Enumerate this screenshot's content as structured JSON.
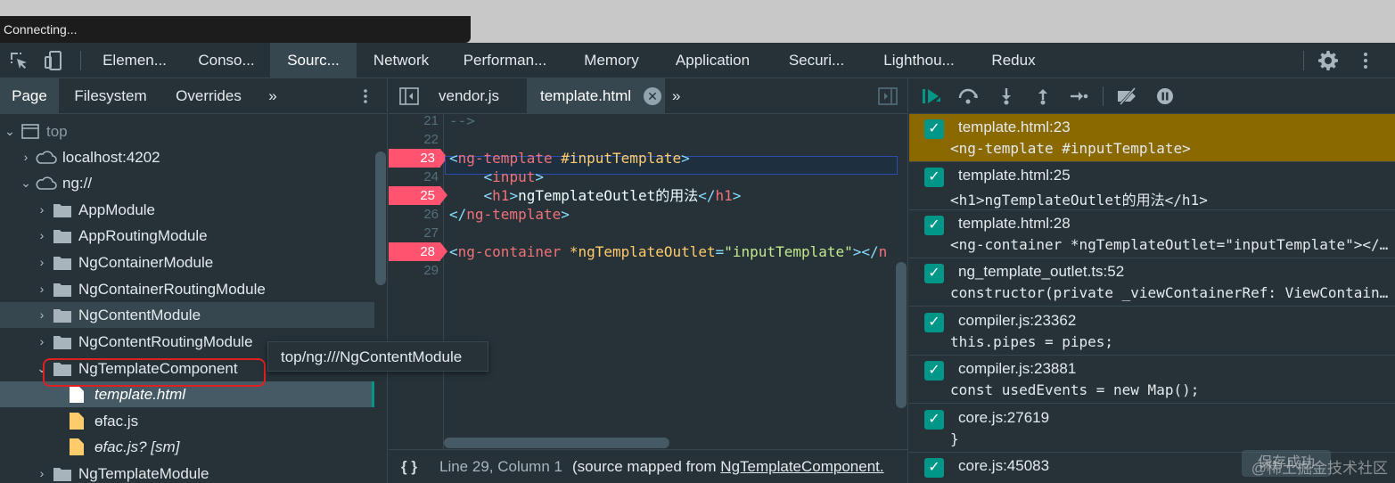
{
  "status_banner": "Connecting...",
  "main_tabs": [
    {
      "label": "Elemen..."
    },
    {
      "label": "Conso..."
    },
    {
      "label": "Sourc..."
    },
    {
      "label": "Network"
    },
    {
      "label": "Performan..."
    },
    {
      "label": "Memory"
    },
    {
      "label": "Application"
    },
    {
      "label": "Securi..."
    },
    {
      "label": "Lighthou..."
    },
    {
      "label": "Redux"
    }
  ],
  "active_main_tab": "Sourc...",
  "navigator": {
    "tabs": [
      "Page",
      "Filesystem",
      "Overrides"
    ],
    "more": "»",
    "tree": [
      {
        "label": "top",
        "icon": "frame-icon"
      },
      {
        "label": "localhost:4202",
        "icon": "cloud-icon"
      },
      {
        "label": "ng://",
        "icon": "cloud-icon"
      },
      {
        "label": "AppModule",
        "icon": "folder-icon"
      },
      {
        "label": "AppRoutingModule",
        "icon": "folder-icon"
      },
      {
        "label": "NgContainerModule",
        "icon": "folder-icon"
      },
      {
        "label": "NgContainerRoutingModule",
        "icon": "folder-icon"
      },
      {
        "label": "NgContentModule",
        "icon": "folder-icon"
      },
      {
        "label": "NgContentRoutingModule",
        "icon": "folder-icon"
      },
      {
        "label": "NgTemplateComponent",
        "icon": "folder-icon"
      },
      {
        "label": "template.html",
        "icon": "file-icon"
      },
      {
        "label": "ɵfac.js",
        "icon": "file-icon"
      },
      {
        "label": "ɵfac.js? [sm]",
        "icon": "file-icon"
      },
      {
        "label": "NgTemplateModule",
        "icon": "folder-icon"
      }
    ],
    "tooltip": "top/ng:///NgContentModule"
  },
  "editor": {
    "tabs": [
      "vendor.js",
      "template.html"
    ],
    "more": "»",
    "lines": [
      {
        "n": "21",
        "tokens": [
          {
            "c": "cm",
            "t": "-->"
          }
        ]
      },
      {
        "n": "22",
        "tokens": []
      },
      {
        "n": "23",
        "bp": true,
        "tokens": [
          {
            "c": "pun",
            "t": "<"
          },
          {
            "c": "tag",
            "t": "ng-template"
          },
          {
            "c": "attr",
            "t": " #inputTemplate"
          },
          {
            "c": "pun",
            "t": ">"
          }
        ]
      },
      {
        "n": "24",
        "tokens": [
          {
            "c": "txt",
            "t": "    "
          },
          {
            "c": "pun",
            "t": "<"
          },
          {
            "c": "tag",
            "t": "input"
          },
          {
            "c": "pun",
            "t": ">"
          }
        ]
      },
      {
        "n": "25",
        "bp": true,
        "tokens": [
          {
            "c": "txt",
            "t": "    "
          },
          {
            "c": "pun",
            "t": "<"
          },
          {
            "c": "tag",
            "t": "h1"
          },
          {
            "c": "pun",
            "t": ">"
          },
          {
            "c": "txt",
            "t": "ngTemplateOutlet的用法"
          },
          {
            "c": "pun",
            "t": "</"
          },
          {
            "c": "tag",
            "t": "h1"
          },
          {
            "c": "pun",
            "t": ">"
          }
        ]
      },
      {
        "n": "26",
        "tokens": [
          {
            "c": "pun",
            "t": "</"
          },
          {
            "c": "tag",
            "t": "ng-template"
          },
          {
            "c": "pun",
            "t": ">"
          }
        ]
      },
      {
        "n": "27",
        "tokens": []
      },
      {
        "n": "28",
        "bp": true,
        "tokens": [
          {
            "c": "pun",
            "t": "<"
          },
          {
            "c": "tag",
            "t": "ng-container"
          },
          {
            "c": "attr",
            "t": " *ngTemplateOutlet"
          },
          {
            "c": "pun",
            "t": "="
          },
          {
            "c": "str",
            "t": "\"inputTemplate\""
          },
          {
            "c": "pun",
            "t": "></"
          },
          {
            "c": "tag",
            "t": "n"
          }
        ]
      },
      {
        "n": "29",
        "tokens": []
      }
    ],
    "status": {
      "braces": "{ }",
      "position": "Line 29, Column 1",
      "source_prefix": "(source mapped from ",
      "source_link": "NgTemplateComponent."
    }
  },
  "debugger": {
    "breakpoints": [
      {
        "location": "template.html:23",
        "code": "<ng-template #inputTemplate>",
        "paused": true
      },
      {
        "location": "template.html:25",
        "code": "<h1>ngTemplateOutlet的用法</h1>"
      },
      {
        "location": "template.html:28",
        "code": "<ng-container *ngTemplateOutlet=\"inputTemplate\"></..."
      },
      {
        "location": "ng_template_outlet.ts:52",
        "code": "constructor(private _viewContainerRef: ViewContain..."
      },
      {
        "location": "compiler.js:23362",
        "code": "this.pipes = pipes;"
      },
      {
        "location": "compiler.js:23881",
        "code": "const usedEvents = new Map();"
      },
      {
        "location": "core.js:27619",
        "code": "}"
      },
      {
        "location": "core.js:45083",
        "code": ""
      }
    ]
  },
  "watermark": "@稀土掘金技术社区",
  "watermark_button": "保存成功"
}
